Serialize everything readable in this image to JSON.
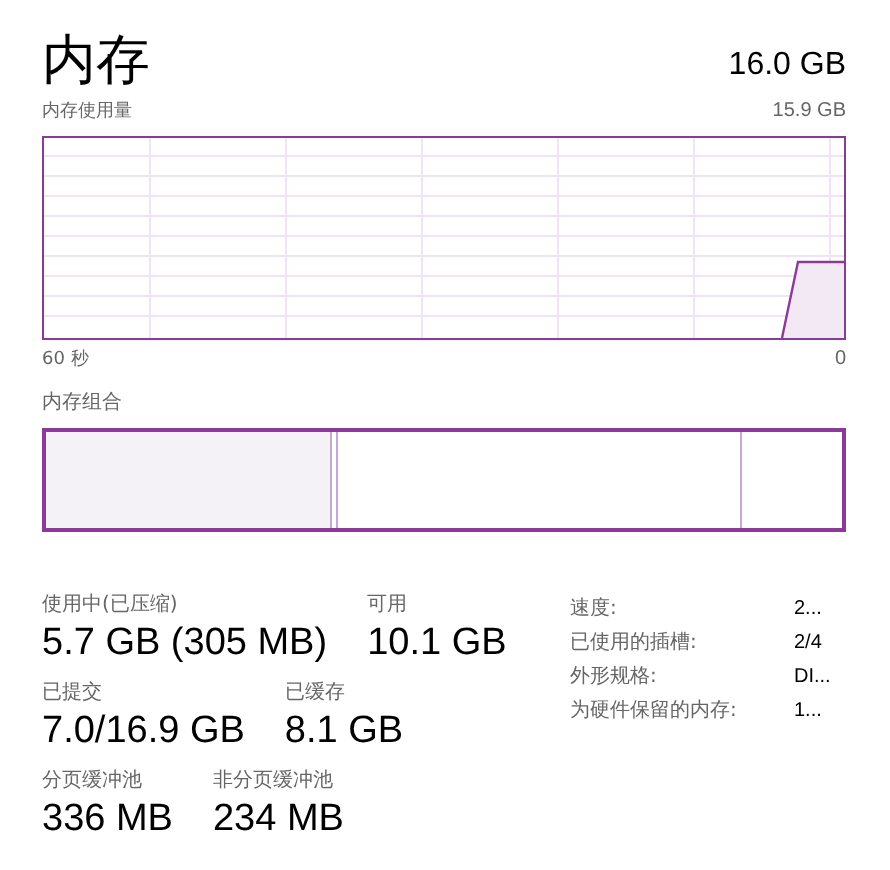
{
  "header": {
    "title": "内存",
    "total": "16.0 GB"
  },
  "usage_graph": {
    "label": "内存使用量",
    "max": "15.9 GB",
    "time_start": "60 秒",
    "time_end": "0"
  },
  "composition": {
    "label": "内存组合"
  },
  "stats": [
    [
      {
        "label": "使用中(已压缩)",
        "value": "5.7 GB (305 MB)"
      },
      {
        "label": "可用",
        "value": "10.1 GB"
      }
    ],
    [
      {
        "label": "已提交",
        "value": "7.0/16.9 GB"
      },
      {
        "label": "已缓存",
        "value": "8.1 GB"
      }
    ],
    [
      {
        "label": "分页缓冲池",
        "value": "336 MB"
      },
      {
        "label": "非分页缓冲池",
        "value": "234 MB"
      }
    ]
  ],
  "details": [
    {
      "label": "速度:",
      "value": "2..."
    },
    {
      "label": "已使用的插槽:",
      "value": "2/4"
    },
    {
      "label": "外形规格:",
      "value": "DI..."
    },
    {
      "label": "为硬件保留的内存:",
      "value": "1..."
    }
  ]
}
